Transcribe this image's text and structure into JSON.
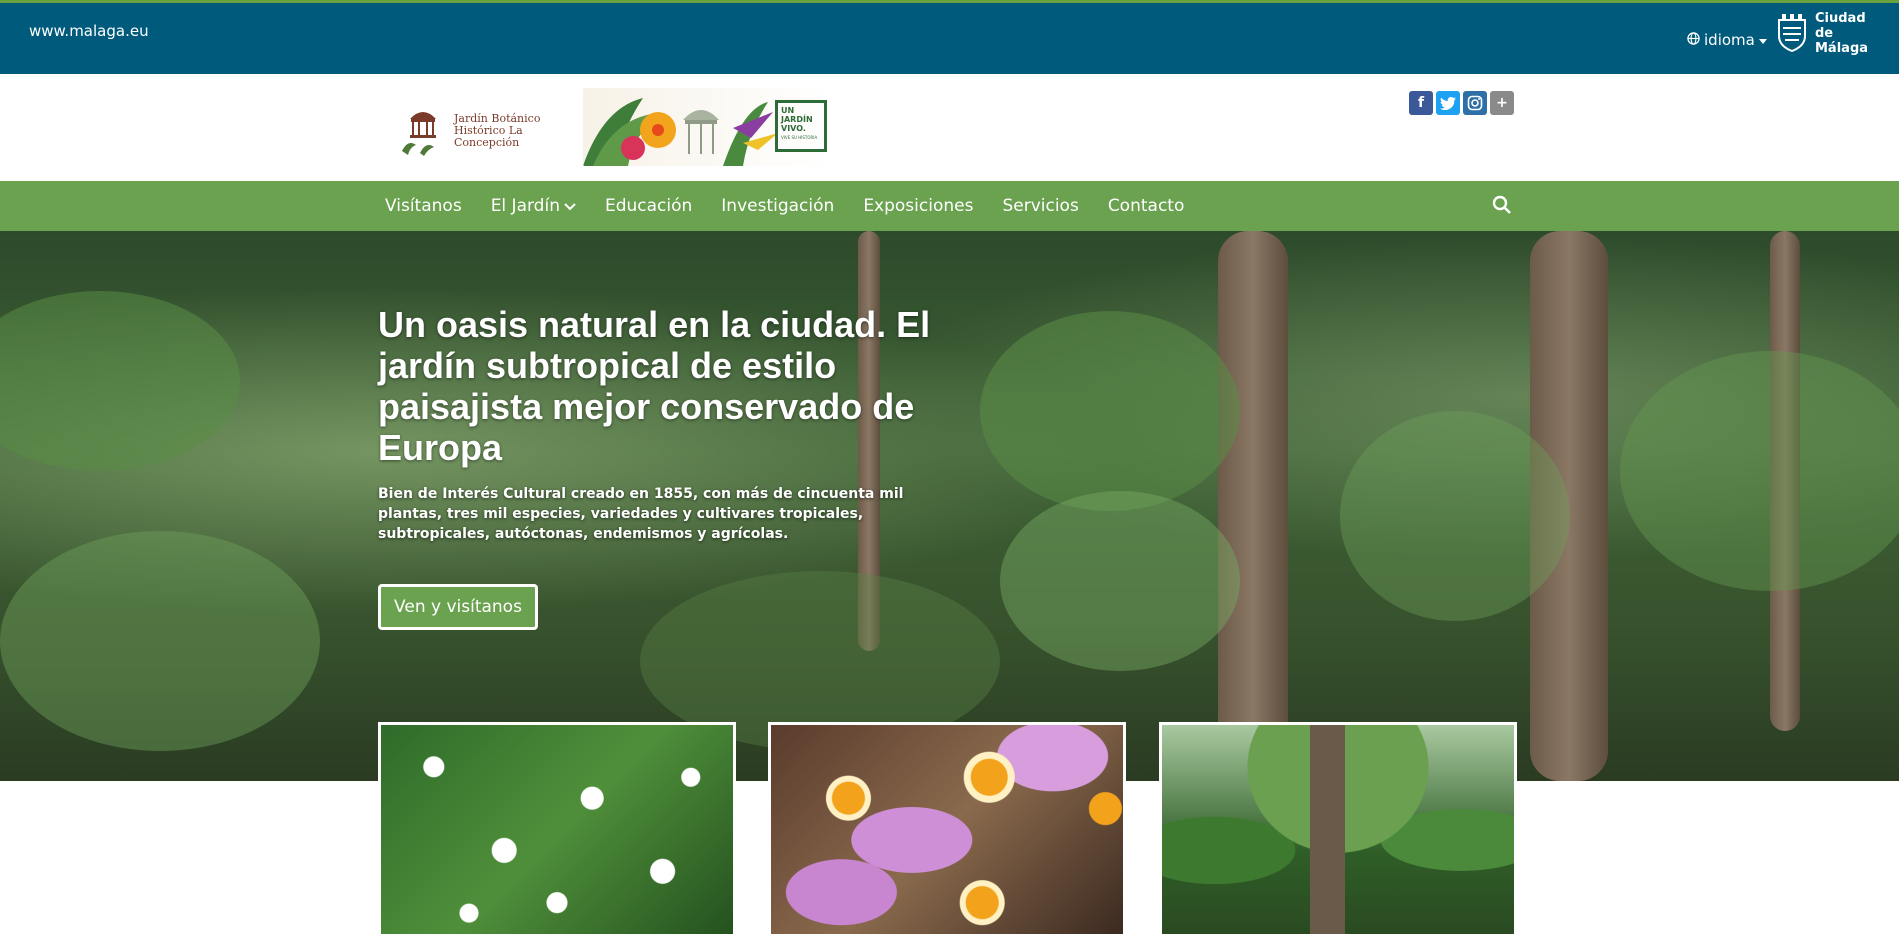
{
  "topbar": {
    "site_link": "www.malaga.eu",
    "language_label": "idioma",
    "city_label": "Ciudad de Málaga"
  },
  "header": {
    "logo_text": "Jardín Botánico Histórico La Concepción",
    "banner_slogan": "UN JARDÍN VIVO.",
    "banner_slogan_small": "VIVE SU HISTORIA",
    "social_icons": [
      "facebook-icon",
      "twitter-icon",
      "instagram-icon",
      "plus-icon"
    ]
  },
  "nav": {
    "items": [
      {
        "label": "Visítanos"
      },
      {
        "label": "El Jardín"
      },
      {
        "label": "Educación"
      },
      {
        "label": "Investigación"
      },
      {
        "label": "Exposiciones"
      },
      {
        "label": "Servicios"
      },
      {
        "label": "Contacto"
      }
    ]
  },
  "hero": {
    "title": "Un oasis natural en la ciudad. El jardín subtropical de estilo paisajista mejor conservado de Europa",
    "subtitle": "Bien de Interés Cultural creado en 1855, con más de cincuenta mil plantas, tres mil especies, variedades y cultivares tropicales, subtropicales, autóctonas, endemismos y agrícolas.",
    "button_label": "Ven y visítanos"
  },
  "colors": {
    "topbar": "#005a7c",
    "nav": "#6aa24f",
    "accent": "#6aa23f",
    "facebook": "#3b5998",
    "twitter": "#1da1f2",
    "instagram": "#2e6fa7",
    "plus": "#8a8a8a"
  }
}
